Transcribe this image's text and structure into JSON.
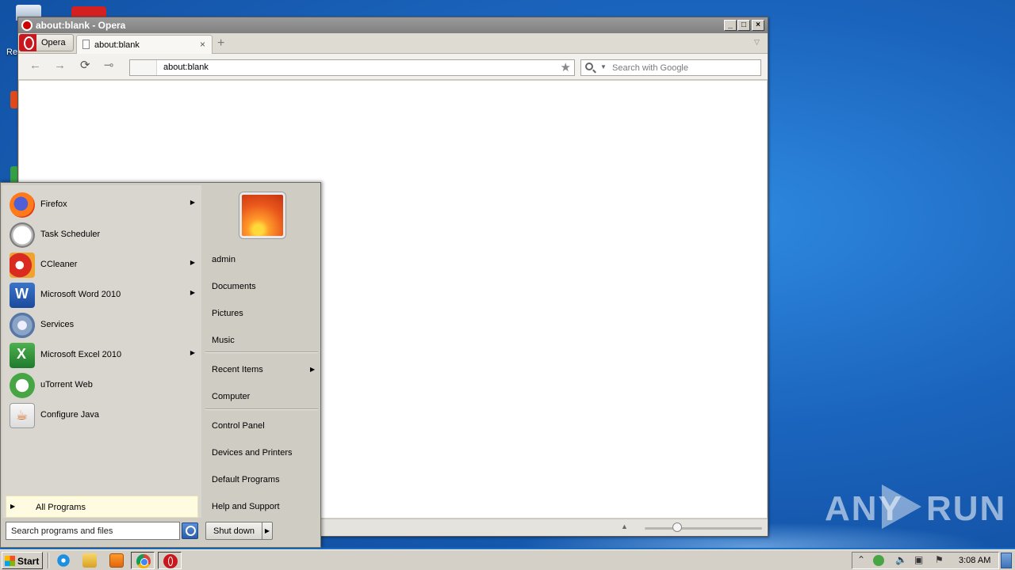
{
  "desktop": {
    "icon_label_partial": "Re"
  },
  "opera_window": {
    "title": "about:blank - Opera",
    "menu_button_label": "Opera",
    "tab_title": "about:blank",
    "tab_close": "×",
    "new_tab": "+",
    "tab_menu": "▽",
    "address_value": "about:blank",
    "search_placeholder": "Search with Google",
    "win_minimize": "_",
    "win_maximize": "□",
    "win_close": "×",
    "zoom_fraction": 0.28
  },
  "start_menu": {
    "programs": [
      {
        "label": "Firefox",
        "icon": "firefox-icon",
        "has_submenu": true
      },
      {
        "label": "Task Scheduler",
        "icon": "task-scheduler-icon",
        "has_submenu": false
      },
      {
        "label": "CCleaner",
        "icon": "ccleaner-icon",
        "has_submenu": true
      },
      {
        "label": "Microsoft Word 2010",
        "icon": "word-icon",
        "has_submenu": true
      },
      {
        "label": "Services",
        "icon": "services-icon",
        "has_submenu": false
      },
      {
        "label": "Microsoft Excel 2010",
        "icon": "excel-icon",
        "has_submenu": true
      },
      {
        "label": "uTorrent Web",
        "icon": "utorrent-icon",
        "has_submenu": false
      },
      {
        "label": "Configure Java",
        "icon": "java-icon",
        "has_submenu": false
      }
    ],
    "all_programs": "All Programs",
    "search_placeholder": "Search programs and files",
    "places": [
      {
        "label": "admin"
      },
      {
        "label": "Documents"
      },
      {
        "label": "Pictures"
      },
      {
        "label": "Music"
      },
      {
        "label": "Recent Items"
      },
      {
        "label": "Computer"
      },
      {
        "label": "Control Panel"
      },
      {
        "label": "Devices and Printers"
      },
      {
        "label": "Default Programs"
      },
      {
        "label": "Help and Support"
      }
    ],
    "shutdown_label": "Shut down",
    "submenu_arrow": "▶"
  },
  "taskbar": {
    "start_label": "Start",
    "clock": "3:08 AM"
  },
  "watermark": {
    "left": "ANY",
    "right": "RUN"
  }
}
